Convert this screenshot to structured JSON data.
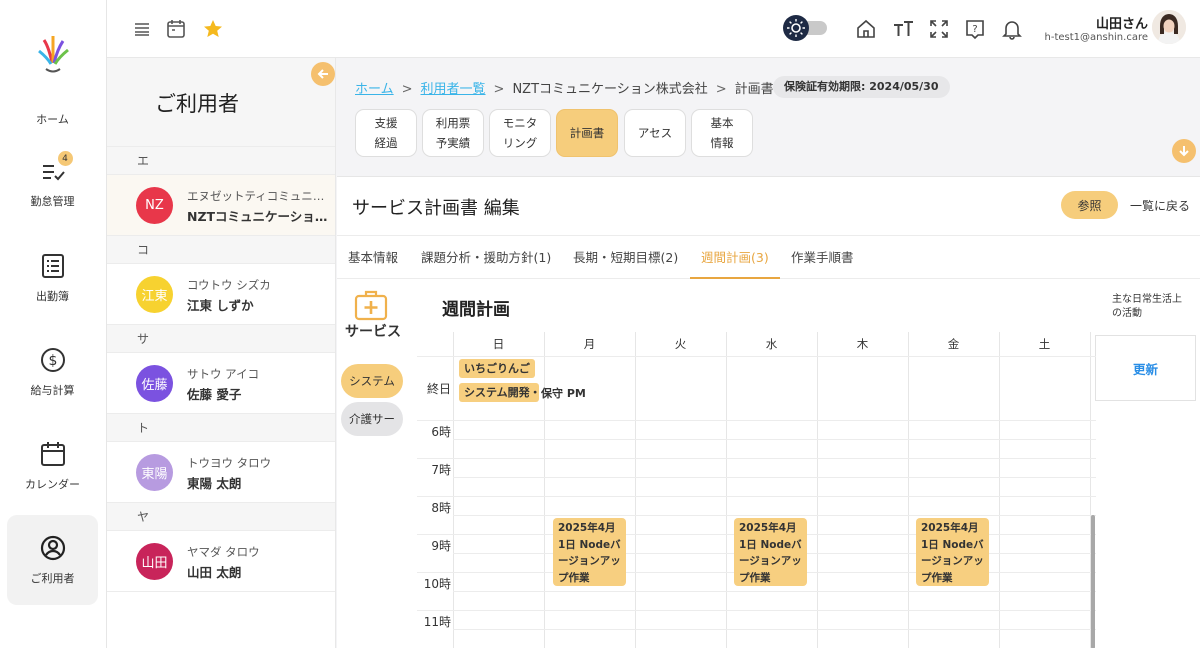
{
  "nav": {
    "items": [
      {
        "label": "ホーム"
      },
      {
        "label": "勤怠管理",
        "badge": "4"
      },
      {
        "label": "出勤簿"
      },
      {
        "label": "給与計算"
      },
      {
        "label": "カレンダー"
      },
      {
        "label": "ご利用者"
      }
    ]
  },
  "topbar": {
    "icons": [
      "menu-icon",
      "calendar-icon",
      "star-icon",
      "theme-toggle",
      "home-icon",
      "text-size-icon",
      "fullscreen-icon",
      "help-icon",
      "bell-icon"
    ],
    "user_name": "山田さん",
    "user_email": "h-test1@anshin.care"
  },
  "userpanel": {
    "title": "ご利用者",
    "sections": [
      {
        "header": "エ",
        "rows": [
          {
            "avatar": "NZ",
            "color": "#e8374a",
            "kana": "エヌゼットティコミュニケーション",
            "name": "NZTコミュニケーション株式会社"
          }
        ]
      },
      {
        "header": "コ",
        "rows": [
          {
            "avatar": "江東",
            "color": "#f7d230",
            "kana": "コウトウ シズカ",
            "name": "江東 しずか"
          }
        ]
      },
      {
        "header": "サ",
        "rows": [
          {
            "avatar": "佐藤",
            "color": "#7b52e0",
            "kana": "サトウ アイコ",
            "name": "佐藤 愛子"
          }
        ]
      },
      {
        "header": "ト",
        "rows": [
          {
            "avatar": "東陽",
            "color": "#b79be0",
            "kana": "トウヨウ タロウ",
            "name": "東陽 太朗"
          }
        ]
      },
      {
        "header": "ヤ",
        "rows": [
          {
            "avatar": "山田",
            "color": "#c8245a",
            "kana": "ヤマダ タロウ",
            "name": "山田 太朗"
          }
        ]
      }
    ]
  },
  "breadcrumb": {
    "home": "ホーム",
    "list": "利用者一覧",
    "client": "NZTコミュニケーション株式会社",
    "current": "計画書",
    "sep": ">"
  },
  "insurance": "保険証有効期限: 2024/05/30",
  "doc_tabs": [
    {
      "l1": "支援",
      "l2": "経過"
    },
    {
      "l1": "利用票",
      "l2": "予実績"
    },
    {
      "l1": "モニタ",
      "l2": "リング"
    },
    {
      "l1": "計画書",
      "l2": ""
    },
    {
      "l1": "アセス",
      "l2": ""
    },
    {
      "l1": "基本",
      "l2": "情報"
    }
  ],
  "card": {
    "title": "サービス計画書 編集",
    "ref_button": "参照",
    "back_link": "一覧に戻る"
  },
  "subtabs": [
    "基本情報",
    "課題分析・援助方針(1)",
    "長期・短期目標(2)",
    "週間計画(3)",
    "作業手順書"
  ],
  "service": {
    "label": "サービス",
    "buttons": [
      {
        "label": "システム",
        "color": "#f6cd7c"
      },
      {
        "label": "介護サー",
        "color": "#e4e4e6"
      }
    ]
  },
  "week": {
    "title": "週間計画",
    "daily_label": "主な日常生活上の活動",
    "update_button": "更新",
    "days": [
      "日",
      "月",
      "火",
      "水",
      "木",
      "金",
      "土"
    ],
    "allday_label": "終日",
    "hours": [
      "6時",
      "7時",
      "8時",
      "9時",
      "10時",
      "11時"
    ],
    "allday_chips": [
      "いちごりんご",
      "システム開発・",
      "保守 PM"
    ],
    "events": [
      {
        "day": "月",
        "text": "2025年4月1日 Nodeバージョンアップ作業"
      },
      {
        "day": "水",
        "text": "2025年4月1日 Nodeバージョンアップ作業"
      },
      {
        "day": "金",
        "text": "2025年4月1日 Nodeバージョンアップ作業"
      }
    ]
  },
  "colors": {
    "accent": "#f6cd7c",
    "accent_text": "#e8a640",
    "link": "#3ab4e8",
    "update": "#2a8ee6"
  }
}
